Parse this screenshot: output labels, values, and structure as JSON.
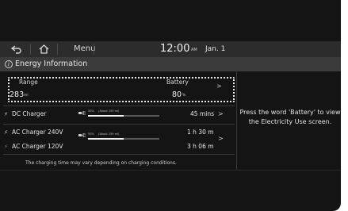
{
  "topbar": {
    "back_icon": "back-arrow-icon",
    "home_icon": "home-icon",
    "menu_label": "Menu",
    "time": "12:00",
    "ampm": "AM",
    "date": "Jan. 1"
  },
  "titlebar": {
    "icon": "info-icon",
    "title": "Energy Information"
  },
  "summary": {
    "range_label": "Range",
    "range_value": "283",
    "range_unit": "mi",
    "battery_label": "Battery",
    "battery_value": "80",
    "battery_unit": "%"
  },
  "chargers": [
    {
      "label": "DC Charger",
      "target_percent": 50,
      "target_label": "50%",
      "about_label": "(About 159 mi)",
      "time": "45 mins"
    },
    {
      "label": "AC Charger 240V",
      "target_percent": 50,
      "target_label": "50%",
      "about_label": "(About 159 mi)",
      "time": "1 h 30 m"
    },
    {
      "label": "AC Charger 120V",
      "time": "3 h 06 m"
    }
  ],
  "footnote": "The charging time may vary depending on charging conditions.",
  "guidance": "Press the word 'Battery' to view the Electricity Use screen.",
  "colors": {
    "screen_bg": "#141414",
    "status_bar": "#2c2c2c",
    "title_bar": "#3b3b3b",
    "text": "#e2e2e2",
    "highlight_border": "#e8e8e8"
  }
}
